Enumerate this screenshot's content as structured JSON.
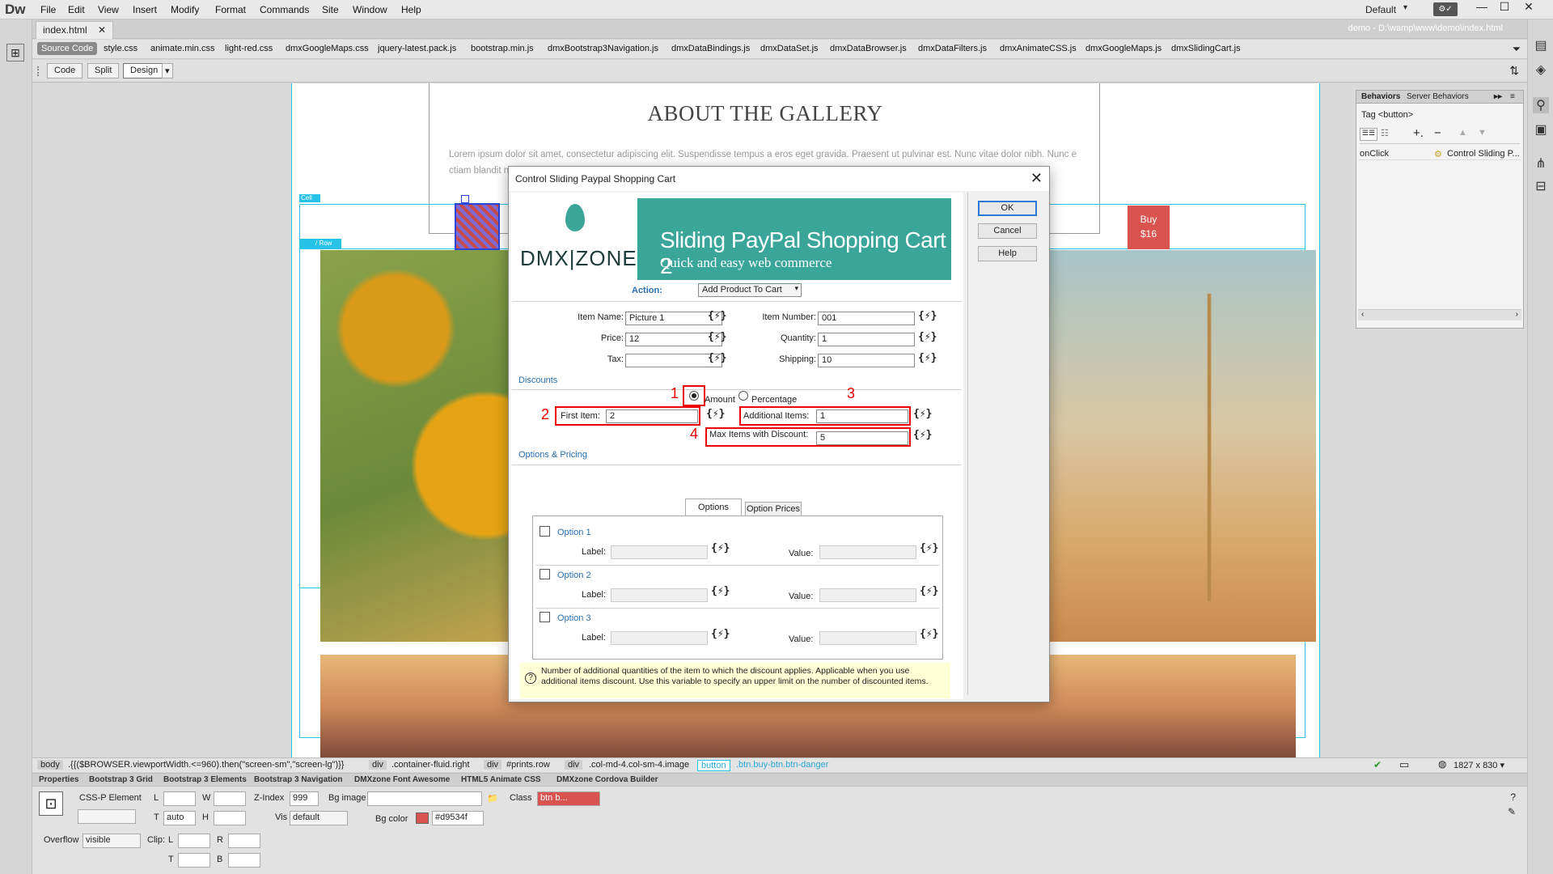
{
  "app": {
    "logo": "Dw",
    "menu": [
      "File",
      "Edit",
      "View",
      "Insert",
      "Modify",
      "Format",
      "Commands",
      "Site",
      "Window",
      "Help"
    ],
    "workspace": "Default",
    "workspace_caret": "▾"
  },
  "document": {
    "tab": "index.html",
    "tab_close": "✕",
    "path": "demo - D:\\wamp\\www\\demo\\index.html",
    "source_code": "Source Code",
    "related_files": [
      "style.css",
      "animate.min.css",
      "light-red.css",
      "dmxGoogleMaps.css",
      "jquery-latest.pack.js",
      "bootstrap.min.js",
      "dmxBootstrap3Navigation.js",
      "dmxDataBindings.js",
      "dmxDataSet.js",
      "dmxDataBrowser.js",
      "dmxDataFilters.js",
      "dmxAnimateCSS.js",
      "dmxGoogleMaps.js",
      "dmxSlidingCart.js"
    ],
    "views": [
      "Code",
      "Split",
      "Design"
    ],
    "view_caret": "▾"
  },
  "canvas": {
    "gallery_title": "ABOUT THE GALLERY",
    "gallery_text": "Lorem ipsum dolor sit amet, consectetur adipiscing elit. Suspendisse tempus a eros eget gravida. Praesent ut pulvinar est. Nunc vitae dolor nibh. Nunc e                                                                                                                        ctiam blandit n                                                                                                                            s, el                                                                                                                                rsus,",
    "cell_tag": "Cell",
    "row_tag": "/ Row",
    "buy_line1": "Buy",
    "buy_line2": "$16"
  },
  "statusbar": {
    "tags": [
      "body",
      ".{{($BROWSER.viewportWidth.<=960).then(\"screen-sm\",\"screen-lg\")}}",
      "div",
      ".container-fluid.right",
      "div",
      "#prints.row",
      "div",
      ".col-md-4.col-sm-4.image",
      "button",
      ".btn.buy-btn.btn-danger"
    ],
    "dimensions": "1827 x 830 ▾"
  },
  "properties": {
    "tabs": [
      "Properties",
      "Bootstrap 3 Grid",
      "Bootstrap 3 Elements",
      "Bootstrap 3 Navigation",
      "DMXzone Font Awesome",
      "HTML5 Animate CSS",
      "DMXzone Cordova Builder"
    ],
    "element_type": "CSS-P Element",
    "L": "L",
    "W": "W",
    "T": "T",
    "H": "H",
    "zindex_label": "Z-Index",
    "zindex": "999",
    "bgimage_label": "Bg image",
    "class_label": "Class",
    "class_value": "btn b...",
    "top_value": "auto",
    "vis_label": "Vis",
    "vis_value": "default",
    "bgcolor_label": "Bg color",
    "bgcolor_value": "#d9534f",
    "overflow_label": "Overflow",
    "overflow_value": "visible",
    "clip_label": "Clip:",
    "clip_L": "L",
    "clip_R": "R",
    "clip_T": "T",
    "clip_B": "B"
  },
  "behaviors": {
    "tabs": [
      "Behaviors",
      "Server Behaviors"
    ],
    "tag": "Tag <button>",
    "event": "onClick",
    "action": "Control Sliding P..."
  },
  "dialog": {
    "title": "Control Sliding Paypal Shopping Cart",
    "close": "✕",
    "logo": "DMX|ZONE",
    "banner_title": "Sliding PayPal Shopping Cart 2",
    "banner_sub": "Quick and easy web commerce",
    "action_label": "Action:",
    "action_value": "Add Product To Cart",
    "item_name_label": "Item Name:",
    "item_name": "Picture 1",
    "item_number_label": "Item Number:",
    "item_number": "001",
    "price_label": "Price:",
    "price": "12",
    "quantity_label": "Quantity:",
    "quantity": "1",
    "tax_label": "Tax:",
    "tax": "",
    "shipping_label": "Shipping:",
    "shipping": "10",
    "dyn_icon": "{⚡}",
    "discounts_heading": "Discounts",
    "amount_label": "Amount",
    "percentage_label": "Percentage",
    "first_item_label": "First Item:",
    "first_item": "2",
    "additional_items_label": "Additional Items:",
    "additional_items": "1",
    "max_items_label": "Max Items with Discount:",
    "max_items": "5",
    "options_heading": "Options & Pricing",
    "tab_options": "Options",
    "tab_option_prices": "Option Prices",
    "options": [
      {
        "name": "Option 1",
        "label": "Label:",
        "value": "Value:"
      },
      {
        "name": "Option 2",
        "label": "Label:",
        "value": "Value:"
      },
      {
        "name": "Option 3",
        "label": "Label:",
        "value": "Value:"
      }
    ],
    "hint": "Number of additional quantities of the item to which the discount applies. Applicable when you use additional items discount. Use this variable to specify an upper limit on the number of discounted items.",
    "buttons": {
      "ok": "OK",
      "cancel": "Cancel",
      "help": "Help"
    },
    "annotations": [
      "1",
      "2",
      "3",
      "4"
    ]
  },
  "colors": {
    "brand": "#3aa69a",
    "danger": "#d9534f",
    "highlight": "#e00000",
    "guide": "#27c2e8"
  }
}
